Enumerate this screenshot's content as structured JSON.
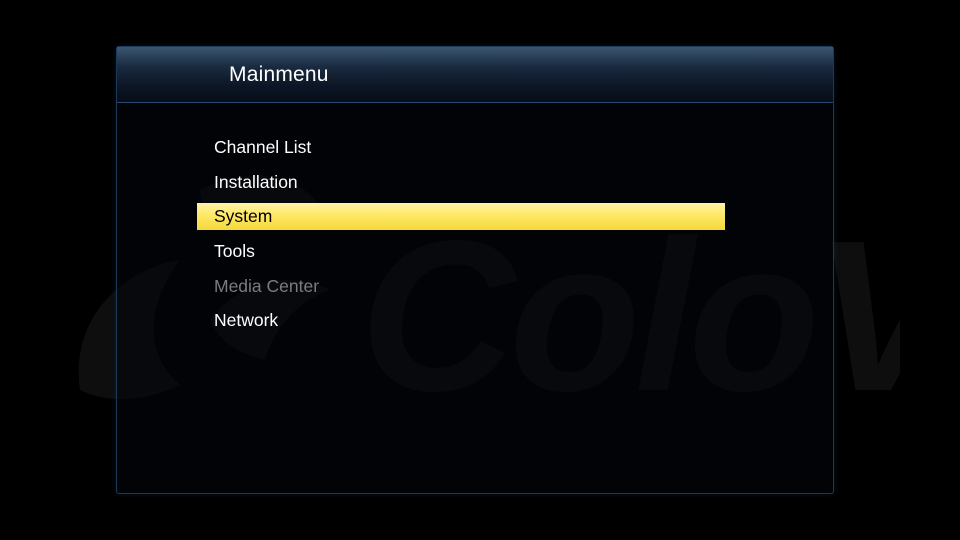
{
  "watermark": {
    "brand": "ColoVu"
  },
  "panel": {
    "title": "Mainmenu"
  },
  "menu": {
    "items": [
      {
        "label": "Channel List",
        "state": "normal"
      },
      {
        "label": "Installation",
        "state": "normal"
      },
      {
        "label": "System",
        "state": "selected"
      },
      {
        "label": "Tools",
        "state": "normal"
      },
      {
        "label": "Media Center",
        "state": "disabled"
      },
      {
        "label": "Network",
        "state": "normal"
      }
    ]
  },
  "colors": {
    "background": "#000000",
    "highlight": "#ffe866",
    "disabled_text": "#7c7c7c",
    "header_accent": "#3b5672"
  }
}
